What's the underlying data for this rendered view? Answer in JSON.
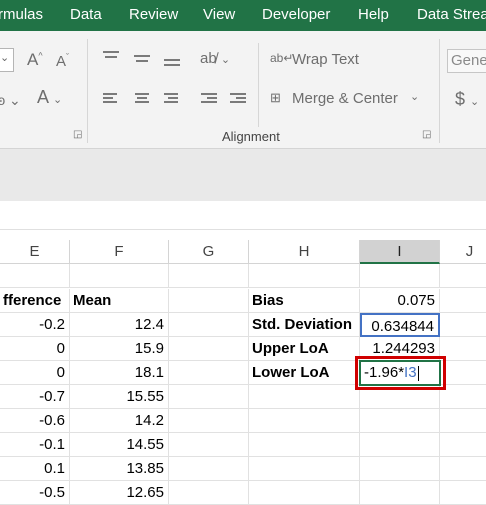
{
  "menu": [
    "rmulas",
    "Data",
    "Review",
    "View",
    "Developer",
    "Help",
    "Data Strea"
  ],
  "ribbon": {
    "wrap_text": "Wrap Text",
    "merge_center": "Merge & Center",
    "alignment_label": "Alignment",
    "number_format": "Gener",
    "currency_symbol": "$",
    "font_color_letter": "A",
    "increase_font_letter": "A",
    "decrease_font_letter": "A"
  },
  "columns": [
    "E",
    "F",
    "G",
    "H",
    "I",
    "J"
  ],
  "selected_column": "I",
  "headers": {
    "e": "fference",
    "f": "Mean"
  },
  "rows": [
    {
      "e": "-0.2",
      "f": "12.4"
    },
    {
      "e": "0",
      "f": "15.9"
    },
    {
      "e": "0",
      "f": "18.1"
    },
    {
      "e": "-0.7",
      "f": "15.55"
    },
    {
      "e": "-0.6",
      "f": "14.2"
    },
    {
      "e": "-0.1",
      "f": "14.55"
    },
    {
      "e": "0.1",
      "f": "13.85"
    },
    {
      "e": "-0.5",
      "f": "12.65"
    }
  ],
  "stats": [
    {
      "label": "Bias",
      "value": "0.075"
    },
    {
      "label": "Std. Deviation",
      "value": "0.634844"
    },
    {
      "label": "Upper LoA",
      "value": "1.244293"
    },
    {
      "label": "Lower LoA",
      "value": ""
    }
  ],
  "formula": {
    "prefix": "-1.96*",
    "ref": "I3"
  },
  "colors": {
    "brand": "#217346",
    "ref_highlight": "#4472c4",
    "annotation": "#d00000"
  }
}
